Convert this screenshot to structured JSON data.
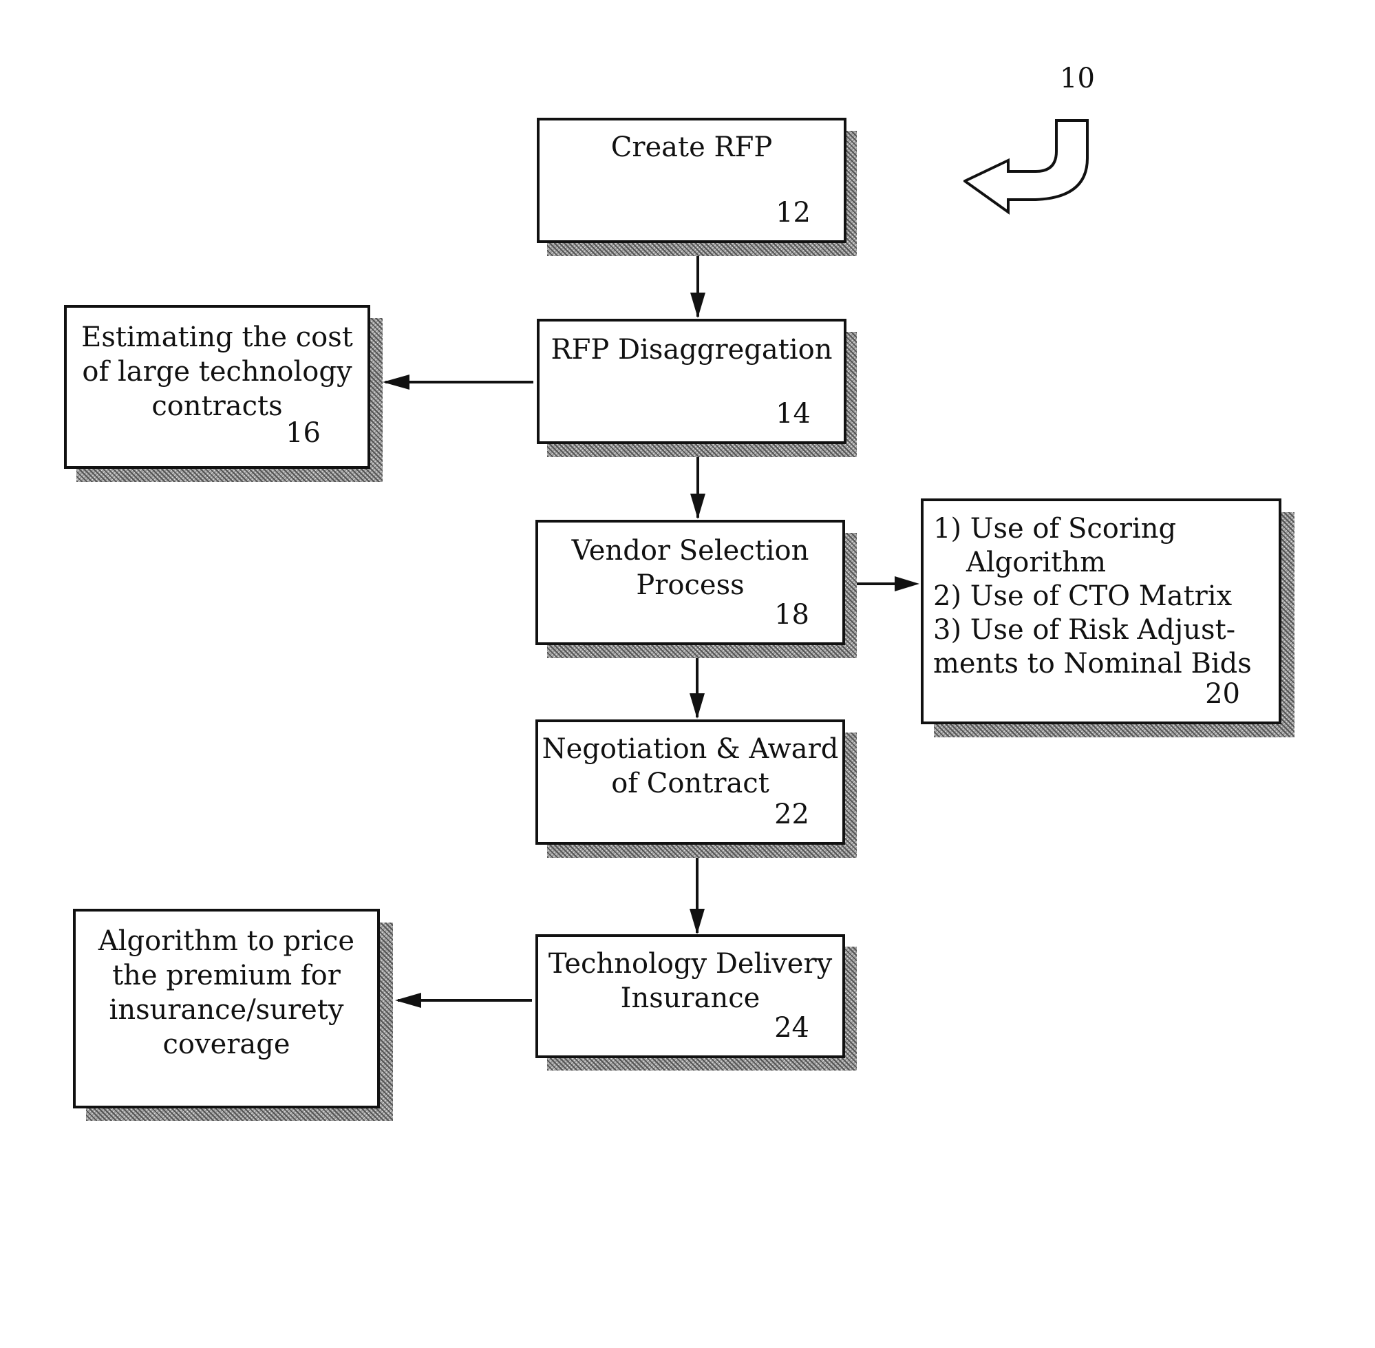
{
  "figure": {
    "reference_numeral": "10",
    "reference_arrow_icon": "curved-arrow-left"
  },
  "nodes": {
    "create_rfp": {
      "label": "Create RFP",
      "number": "12"
    },
    "rfp_disaggregation": {
      "label": "RFP Disaggregation",
      "number": "14"
    },
    "estimating_cost": {
      "label": "Estimating the cost\nof large technology\ncontracts",
      "number": "16"
    },
    "vendor_selection": {
      "label": "Vendor Selection\nProcess",
      "number": "18"
    },
    "selection_methods": {
      "items": [
        {
          "prefix": "1)",
          "text": "Use of Scoring",
          "cont": "Algorithm"
        },
        {
          "prefix": "2)",
          "text": "Use of CTO Matrix"
        },
        {
          "prefix": "3)",
          "text": "Use of Risk Adjust-",
          "cont": "ments to Nominal Bids"
        }
      ],
      "line1": "1) Use of Scoring",
      "line2": "Algorithm",
      "line3": "2) Use of CTO Matrix",
      "line4": "3) Use of Risk Adjust-",
      "line5": "ments to Nominal Bids",
      "number": "20"
    },
    "negotiation_award": {
      "label": "Negotiation & Award\nof Contract",
      "number": "22"
    },
    "technology_delivery_insurance": {
      "label": "Technology Delivery\nInsurance",
      "number": "24"
    },
    "premium_algorithm": {
      "label": "Algorithm to price\nthe premium for\ninsurance/surety\ncoverage"
    }
  },
  "edges": [
    {
      "from": "create_rfp",
      "to": "rfp_disaggregation"
    },
    {
      "from": "rfp_disaggregation",
      "to": "estimating_cost"
    },
    {
      "from": "rfp_disaggregation",
      "to": "vendor_selection"
    },
    {
      "from": "vendor_selection",
      "to": "selection_methods"
    },
    {
      "from": "vendor_selection",
      "to": "negotiation_award"
    },
    {
      "from": "negotiation_award",
      "to": "technology_delivery_insurance"
    },
    {
      "from": "technology_delivery_insurance",
      "to": "premium_algorithm"
    }
  ]
}
